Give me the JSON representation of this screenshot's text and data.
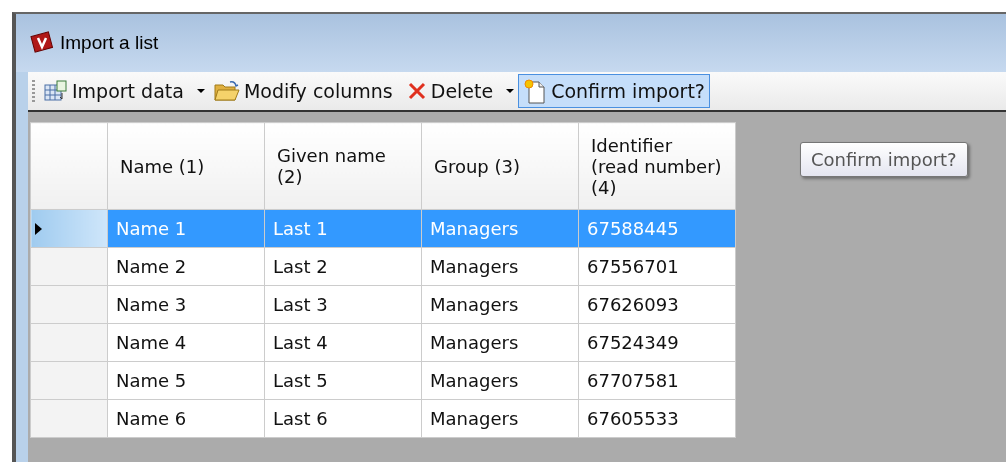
{
  "window": {
    "title": "Import a list"
  },
  "toolbar": [
    {
      "kind": "dropdown",
      "label": "Import data",
      "selected": false
    },
    {
      "kind": "button",
      "label": "Modify columns",
      "selected": false
    },
    {
      "kind": "dropdown",
      "label": "Delete",
      "selected": false
    },
    {
      "kind": "button",
      "label": "Confirm import?",
      "selected": true
    }
  ],
  "table": {
    "columns": [
      "Name (1)",
      "Given name (2)",
      "Group (3)",
      "Identifier (read number) (4)"
    ],
    "rows": [
      {
        "cells": [
          "Name 1",
          "Last 1",
          "Managers",
          "67588445"
        ],
        "selected": true
      },
      {
        "cells": [
          "Name 2",
          "Last 2",
          "Managers",
          "67556701"
        ],
        "selected": false
      },
      {
        "cells": [
          "Name 3",
          "Last 3",
          "Managers",
          "67626093"
        ],
        "selected": false
      },
      {
        "cells": [
          "Name 4",
          "Last 4",
          "Managers",
          "67524349"
        ],
        "selected": false
      },
      {
        "cells": [
          "Name 5",
          "Last 5",
          "Managers",
          "67707581"
        ],
        "selected": false
      },
      {
        "cells": [
          "Name 6",
          "Last 6",
          "Managers",
          "67605533"
        ],
        "selected": false
      }
    ]
  },
  "tooltip": "Confirm import?"
}
